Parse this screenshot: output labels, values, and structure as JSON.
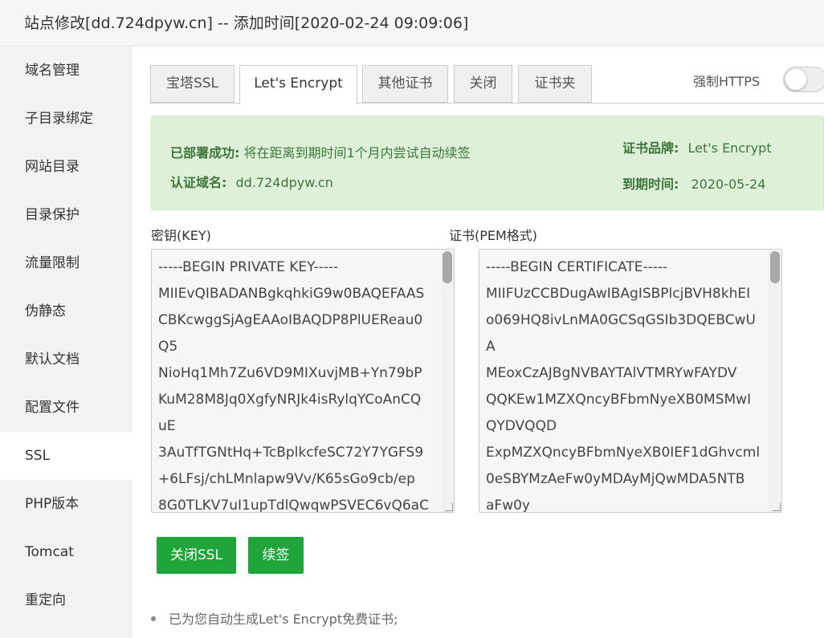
{
  "window": {
    "title": "站点修改[dd.724dpyw.cn] -- 添加时间[2020-02-24 09:09:06]"
  },
  "sidebar": {
    "items": [
      {
        "label": "域名管理"
      },
      {
        "label": "子目录绑定"
      },
      {
        "label": "网站目录"
      },
      {
        "label": "目录保护"
      },
      {
        "label": "流量限制"
      },
      {
        "label": "伪静态"
      },
      {
        "label": "默认文档"
      },
      {
        "label": "配置文件"
      },
      {
        "label": "SSL",
        "active": true
      },
      {
        "label": "PHP版本"
      },
      {
        "label": "Tomcat"
      },
      {
        "label": "重定向"
      }
    ]
  },
  "tabs": [
    {
      "label": "宝塔SSL"
    },
    {
      "label": "Let's Encrypt",
      "active": true
    },
    {
      "label": "其他证书"
    },
    {
      "label": "关闭"
    },
    {
      "label": "证书夹"
    }
  ],
  "force_https": {
    "label": "强制HTTPS",
    "enabled": false
  },
  "status": {
    "deployed_key": "已部署成功:",
    "deployed_value": "将在距离到期时间1个月内尝试自动续签",
    "domain_key": "认证域名:",
    "domain_value": "dd.724dpyw.cn",
    "brand_key": "证书品牌:",
    "brand_value": "Let's Encrypt",
    "expiry_key": "到期时间:",
    "expiry_value": "2020-05-24"
  },
  "key_field": {
    "label": "密钥(KEY)",
    "lines": [
      "-----BEGIN PRIVATE KEY-----",
      "MIIEvQIBADANBgkqhkiG9w0BAQEFAAS",
      "CBKcwggSjAgEAAoIBAQDP8PlUEReau0",
      "Q5",
      "NioHq1Mh7Zu6VD9MIXuvjMB+Yn79bP",
      "KuM28M8Jq0XgfyNRJk4isRylqYCoAnCQ",
      "uE",
      "3AuTfTGNtHq+TcBplkcfeSC72Y7YGFS9",
      "+6LFsj/chLMnlapw9Vv/K65sGo9cb/ep",
      "8G0TLKV7uI1upTdlQwqwPSVEC6vQ6aC"
    ]
  },
  "cert_field": {
    "label": "证书(PEM格式)",
    "lines": [
      "-----BEGIN CERTIFICATE-----",
      "MIIFUzCCBDugAwIBAgISBPlcjBVH8khEI",
      "o069HQ8ivLnMA0GCSqGSIb3DQEBCwU",
      "A",
      "MEoxCzAJBgNVBAYTAlVTMRYwFAYDV",
      "QQKEw1MZXQncyBFbmNyeXB0MSMwI",
      "QYDVQQD",
      "ExpMZXQncyBFbmNyeXB0IEF1dGhvcml",
      "0eSBYMzAeFw0yMDAyMjQwMDA5NTB",
      "aFw0y"
    ]
  },
  "buttons": {
    "close_ssl": "关闭SSL",
    "renew": "续签"
  },
  "notes": [
    "已为您自动生成Let's Encrypt免费证书;"
  ],
  "colors": {
    "accent": "#20a53a",
    "success_bg": "#dff0d8",
    "success_text": "#3c763d"
  }
}
